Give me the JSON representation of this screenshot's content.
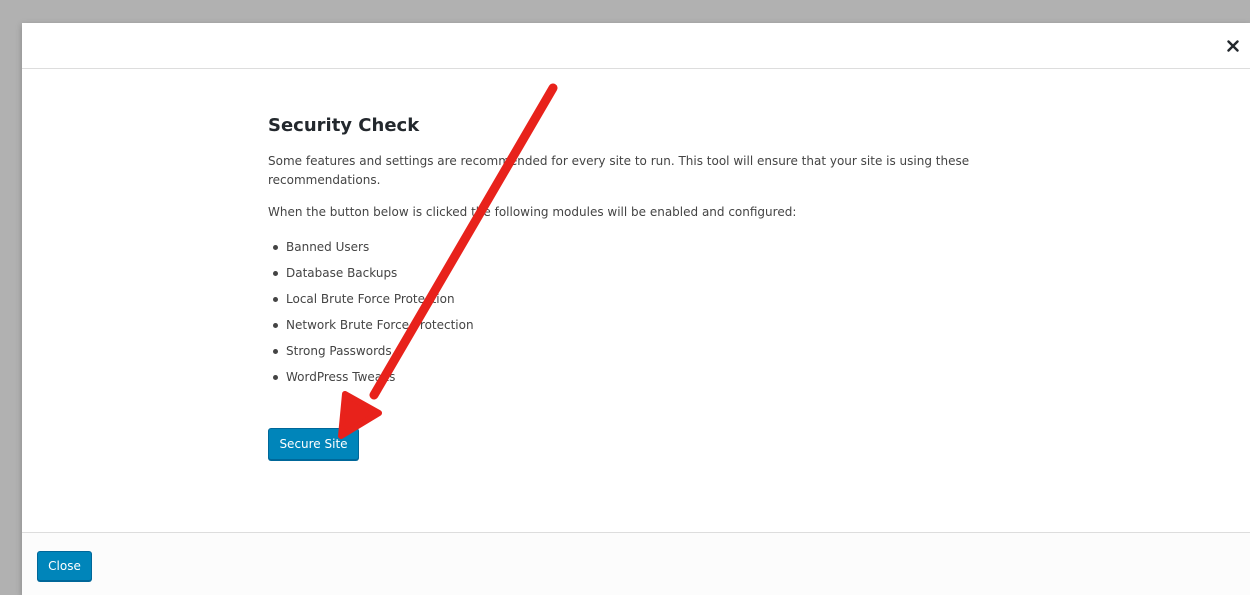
{
  "modal": {
    "close_glyph": "✕",
    "title": "Security Check",
    "intro": "Some features and settings are recommended for every site to run. This tool will ensure that your site is using these recommendations.",
    "modules_intro": "When the button below is clicked the following modules will be enabled and configured:",
    "modules": [
      "Banned Users",
      "Database Backups",
      "Local Brute Force Protection",
      "Network Brute Force Protection",
      "Strong Passwords",
      "WordPress Tweaks"
    ],
    "secure_button_label": "Secure Site",
    "footer_close_label": "Close"
  },
  "annotation": {
    "arrow_color": "#e8221b",
    "target": "secure-site-button"
  },
  "colors": {
    "primary_button": "#0085ba",
    "primary_button_border": "#006799",
    "backdrop": "#b1b1b1"
  }
}
